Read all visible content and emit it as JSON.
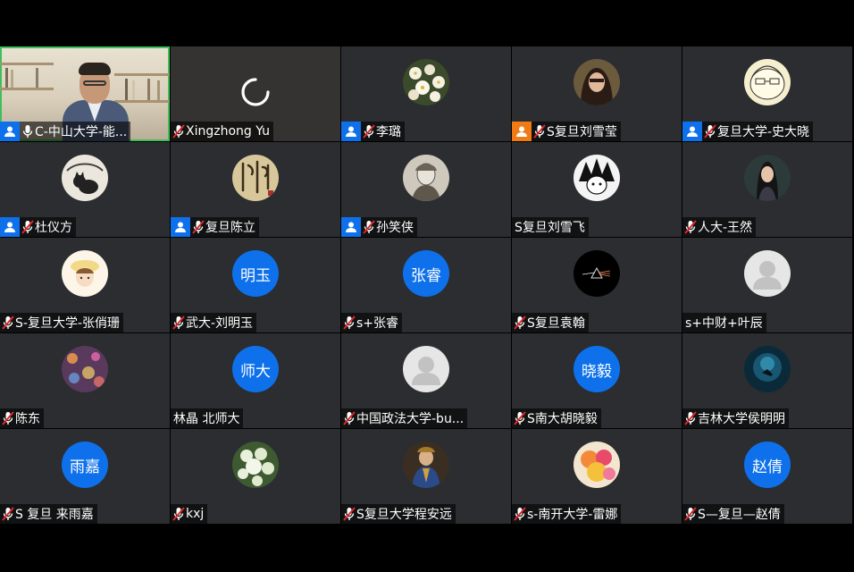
{
  "meeting": {
    "tiles": [
      {
        "name": "C-中山大学-能...",
        "mic": "on"
      },
      {
        "name": "Xingzhong Yu",
        "mic": "muted"
      },
      {
        "name": "李璐",
        "mic": "muted"
      },
      {
        "name": "S复旦刘雪莹",
        "mic": "muted"
      },
      {
        "name": "复旦大学-史大晓",
        "mic": "muted"
      },
      {
        "name": "杜仪方",
        "mic": "muted"
      },
      {
        "name": "复旦陈立",
        "mic": "muted"
      },
      {
        "name": "孙笑侠",
        "mic": "muted"
      },
      {
        "name": "S复旦刘雪飞",
        "mic": "none"
      },
      {
        "name": "人大-王然",
        "mic": "muted"
      },
      {
        "name": "S-复旦大学-张俏珊",
        "mic": "muted"
      },
      {
        "name": "武大-刘明玉",
        "mic": "muted",
        "initials": "明玉"
      },
      {
        "name": "s+张睿",
        "mic": "muted",
        "initials": "张睿"
      },
      {
        "name": "S复旦袁翰",
        "mic": "muted"
      },
      {
        "name": "s+中财+叶辰",
        "mic": "none"
      },
      {
        "name": "陈东",
        "mic": "muted"
      },
      {
        "name": "林晶 北师大",
        "mic": "none",
        "initials": "师大"
      },
      {
        "name": "中国政法大学-bu...",
        "mic": "muted"
      },
      {
        "name": "S南大胡晓毅",
        "mic": "muted",
        "initials": "晓毅"
      },
      {
        "name": "吉林大学侯明明",
        "mic": "muted"
      },
      {
        "name": "S 复旦 来雨嘉",
        "mic": "muted",
        "initials": "雨嘉"
      },
      {
        "name": "kxj",
        "mic": "muted"
      },
      {
        "name": "S复旦大学程安远",
        "mic": "muted"
      },
      {
        "name": "s-南开大学-雷娜",
        "mic": "muted"
      },
      {
        "name": "S—复旦—赵倩",
        "mic": "muted",
        "initials": "赵倩"
      }
    ]
  }
}
